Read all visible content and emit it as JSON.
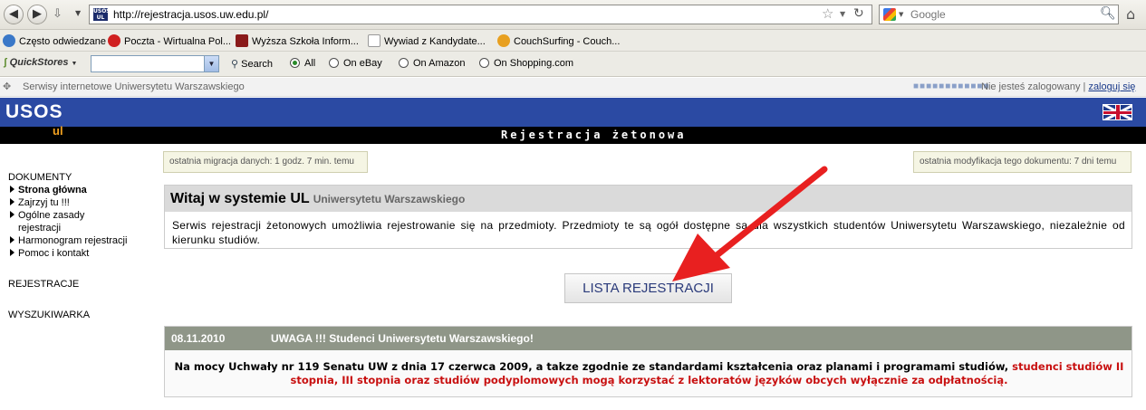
{
  "browser": {
    "url": "http://rejestracja.usos.uw.edu.pl/",
    "favicon_text": "USOS UL",
    "search_placeholder": "Google"
  },
  "bookmarks": [
    {
      "label": "Często odwiedzane",
      "color": "#3a78c8"
    },
    {
      "label": "Poczta - Wirtualna Pol...",
      "color": "#d02020"
    },
    {
      "label": "Wyższa Szkoła Inform...",
      "color": "#8a1a1a"
    },
    {
      "label": "Wywiad z Kandydate...",
      "color": "#ffffff"
    },
    {
      "label": "CouchSurfing - Couch...",
      "color": "#e8a020"
    }
  ],
  "quickstores": {
    "brand": "QuickStores",
    "search_label": "Search",
    "options": [
      {
        "label": "All",
        "selected": true
      },
      {
        "label": "On eBay",
        "selected": false
      },
      {
        "label": "On Amazon",
        "selected": false
      },
      {
        "label": "On Shopping.com",
        "selected": false
      }
    ]
  },
  "service_bar": {
    "title": "Serwisy internetowe Uniwersytetu Warszawskiego",
    "dots": "■■■■■■■■■■■■",
    "not_logged": "Nie jesteś zalogowany |",
    "login_link": "zaloguj się"
  },
  "header": {
    "logo": "USOS",
    "sub_logo": "ul",
    "page_title": "Rejestracja żetonowa"
  },
  "sidebar": {
    "section_documents": "DOKUMENTY",
    "items": [
      {
        "label": "Strona główna",
        "active": true
      },
      {
        "label": "Zajrzyj tu !!!",
        "active": false
      },
      {
        "label": "Ogólne zasady",
        "active": false
      },
      {
        "label": "rejestracji",
        "active": false
      },
      {
        "label": "Harmonogram rejestracji",
        "active": false
      },
      {
        "label": "Pomoc i kontakt",
        "active": false
      }
    ],
    "section_registrations": "REJESTRACJE",
    "section_search": "WYSZUKIWARKA"
  },
  "main": {
    "migration_info": "ostatnia migracja danych: 1 godz. 7 min. temu",
    "modification_info": "ostatnia modyfikacja tego dokumentu: 7 dni temu",
    "welcome_title": "Witaj w systemie UL",
    "welcome_subtitle": "Uniwersytetu Warszawskiego",
    "welcome_text": "Serwis rejestracji żetonowych umożliwia rejestrowanie się na przedmioty. Przedmioty te są ogół dostępne są dla wszystkich studentów Uniwersytetu Warszawskiego, niezależnie od kierunku studiów.",
    "list_button": "LISTA REJESTRACJI",
    "news_date": "08.11.2010",
    "news_title": "UWAGA !!! Studenci Uniwersytetu Warszawskiego!",
    "news_text_black": "Na mocy Uchwały nr 119 Senatu UW z dnia 17 czerwca 2009, a takze zgodnie ze standardami kształcenia oraz planami i programami studiów,",
    "news_text_red": "studenci studiów II stopnia, III stopnia oraz studiów podyplomowych mogą korzystać z lektoratów języków obcych wyłącznie za odpłatnością."
  },
  "colors": {
    "usos_blue": "#2b4aa3",
    "accent_orange": "#f0a020",
    "news_header": "#8f9688",
    "warning_red": "#c81010",
    "annotation_arrow": "#e82020"
  }
}
